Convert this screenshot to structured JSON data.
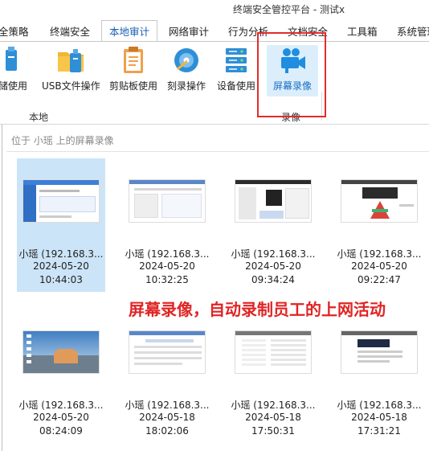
{
  "window": {
    "title": "终端安全管控平台 - 测试x"
  },
  "tabs": [
    {
      "label": "全策略"
    },
    {
      "label": "终端安全"
    },
    {
      "label": "本地审计"
    },
    {
      "label": "网络审计"
    },
    {
      "label": "行为分析"
    },
    {
      "label": "文档安全"
    },
    {
      "label": "工具箱"
    },
    {
      "label": "系统管理"
    }
  ],
  "ribbon": {
    "buttons": [
      {
        "label": "存储使用",
        "icon": "storage-icon"
      },
      {
        "label": "USB文件操作",
        "icon": "usb-folder-icon"
      },
      {
        "label": "剪贴板使用",
        "icon": "clipboard-icon"
      },
      {
        "label": "刻录操作",
        "icon": "disc-burn-icon"
      },
      {
        "label": "设备使用",
        "icon": "device-icon"
      },
      {
        "label": "屏幕录像",
        "icon": "video-camera-icon"
      }
    ],
    "groups": [
      {
        "label": "本地"
      },
      {
        "label": "录像"
      }
    ]
  },
  "panel": {
    "breadcrumb": "位于 小瑶 上的屏幕录像",
    "items": [
      {
        "name": "小瑶 (192.168.3...",
        "date": "2024-05-20",
        "time": "10:44:03"
      },
      {
        "name": "小瑶 (192.168.3...",
        "date": "2024-05-20",
        "time": "10:32:25"
      },
      {
        "name": "小瑶 (192.168.3...",
        "date": "2024-05-20",
        "time": "09:34:24"
      },
      {
        "name": "小瑶 (192.168.3...",
        "date": "2024-05-20",
        "time": "09:22:47"
      },
      {
        "name": "小瑶 (192.168.3...",
        "date": "2024-05-20",
        "time": "08:24:09"
      },
      {
        "name": "小瑶 (192.168.3...",
        "date": "2024-05-18",
        "time": "18:02:06"
      },
      {
        "name": "小瑶 (192.168.3...",
        "date": "2024-05-18",
        "time": "17:50:31"
      },
      {
        "name": "小瑶 (192.168.3...",
        "date": "2024-05-18",
        "time": "17:31:21"
      }
    ]
  },
  "annotation": "屏幕录像，自动录制员工的上网活动",
  "colors": {
    "accent": "#1a6fc4",
    "selection": "#cce4f7",
    "highlight_box": "#e32b2b",
    "annotation_text": "#e02424"
  }
}
